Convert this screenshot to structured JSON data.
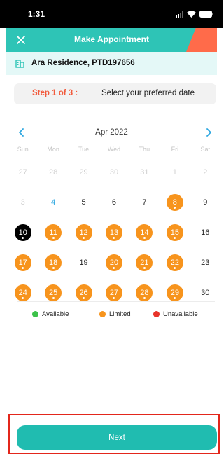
{
  "status_bar": {
    "time": "1:31"
  },
  "header": {
    "title": "Make Appointment",
    "accent_color": "#2ec4b6",
    "corner_color": "#ff6b4a"
  },
  "residence": {
    "name": "Ara Residence, PTD197656"
  },
  "step": {
    "label": "Step 1 of 3 :",
    "text": "Select your preferred date"
  },
  "calendar": {
    "month": "Apr 2022",
    "weekdays": [
      "Sun",
      "Mon",
      "Tue",
      "Wed",
      "Thu",
      "Fri",
      "Sat"
    ],
    "days": [
      {
        "d": "27",
        "s": "muted"
      },
      {
        "d": "28",
        "s": "muted"
      },
      {
        "d": "29",
        "s": "muted"
      },
      {
        "d": "30",
        "s": "muted"
      },
      {
        "d": "31",
        "s": "muted"
      },
      {
        "d": "1",
        "s": "muted"
      },
      {
        "d": "2",
        "s": "muted"
      },
      {
        "d": "3",
        "s": "muted"
      },
      {
        "d": "4",
        "s": "today"
      },
      {
        "d": "5",
        "s": "normal"
      },
      {
        "d": "6",
        "s": "normal"
      },
      {
        "d": "7",
        "s": "normal"
      },
      {
        "d": "8",
        "s": "limited"
      },
      {
        "d": "9",
        "s": "normal"
      },
      {
        "d": "10",
        "s": "selected"
      },
      {
        "d": "11",
        "s": "limited"
      },
      {
        "d": "12",
        "s": "limited"
      },
      {
        "d": "13",
        "s": "limited"
      },
      {
        "d": "14",
        "s": "limited"
      },
      {
        "d": "15",
        "s": "limited"
      },
      {
        "d": "16",
        "s": "normal"
      },
      {
        "d": "17",
        "s": "limited"
      },
      {
        "d": "18",
        "s": "limited"
      },
      {
        "d": "19",
        "s": "normal"
      },
      {
        "d": "20",
        "s": "limited"
      },
      {
        "d": "21",
        "s": "limited"
      },
      {
        "d": "22",
        "s": "limited"
      },
      {
        "d": "23",
        "s": "normal"
      },
      {
        "d": "24",
        "s": "limited"
      },
      {
        "d": "25",
        "s": "limited"
      },
      {
        "d": "26",
        "s": "limited"
      },
      {
        "d": "27",
        "s": "limited"
      },
      {
        "d": "28",
        "s": "limited"
      },
      {
        "d": "29",
        "s": "limited"
      },
      {
        "d": "30",
        "s": "normal"
      }
    ]
  },
  "legend": [
    {
      "label": "Available",
      "color": "#3cc24a"
    },
    {
      "label": "Limited",
      "color": "#f7941d"
    },
    {
      "label": "Unavailable",
      "color": "#e8342a"
    }
  ],
  "actions": {
    "next_label": "Next"
  }
}
